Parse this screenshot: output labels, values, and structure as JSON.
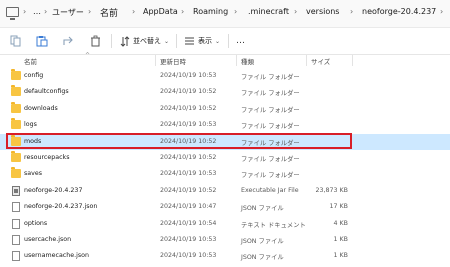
{
  "address": {
    "crumbs": [
      "ユーザー",
      "名前",
      "AppData",
      "Roaming",
      ".minecraft",
      "versions",
      "neoforge-20.4.237"
    ],
    "more": "…"
  },
  "toolbar": {
    "sort_label": "並べ替え",
    "view_label": "表示",
    "more_label": "…"
  },
  "columns": {
    "name": "名前",
    "date": "更新日時",
    "type": "種類",
    "size": "サイズ"
  },
  "files": [
    {
      "name": "config",
      "date": "2024/10/19 10:53",
      "type": "ファイル フォルダー",
      "size": "",
      "icon": "folder"
    },
    {
      "name": "defaultconfigs",
      "date": "2024/10/19 10:52",
      "type": "ファイル フォルダー",
      "size": "",
      "icon": "folder"
    },
    {
      "name": "downloads",
      "date": "2024/10/19 10:52",
      "type": "ファイル フォルダー",
      "size": "",
      "icon": "folder"
    },
    {
      "name": "logs",
      "date": "2024/10/19 10:53",
      "type": "ファイル フォルダー",
      "size": "",
      "icon": "folder"
    },
    {
      "name": "mods",
      "date": "2024/10/19 10:52",
      "type": "ファイル フォルダー",
      "size": "",
      "icon": "folder",
      "selected": true
    },
    {
      "name": "resourcepacks",
      "date": "2024/10/19 10:52",
      "type": "ファイル フォルダー",
      "size": "",
      "icon": "folder"
    },
    {
      "name": "saves",
      "date": "2024/10/19 10:53",
      "type": "ファイル フォルダー",
      "size": "",
      "icon": "folder"
    },
    {
      "name": "neoforge-20.4.237",
      "date": "2024/10/19 10:52",
      "type": "Executable Jar File",
      "size": "23,873 KB",
      "icon": "jar"
    },
    {
      "name": "neoforge-20.4.237.json",
      "date": "2024/10/19 10:47",
      "type": "JSON ファイル",
      "size": "17 KB",
      "icon": "file"
    },
    {
      "name": "options",
      "date": "2024/10/19 10:54",
      "type": "テキスト ドキュメント",
      "size": "4 KB",
      "icon": "file"
    },
    {
      "name": "usercache.json",
      "date": "2024/10/19 10:53",
      "type": "JSON ファイル",
      "size": "1 KB",
      "icon": "file"
    },
    {
      "name": "usernamecache.json",
      "date": "2024/10/19 10:53",
      "type": "JSON ファイル",
      "size": "1 KB",
      "icon": "file"
    }
  ]
}
